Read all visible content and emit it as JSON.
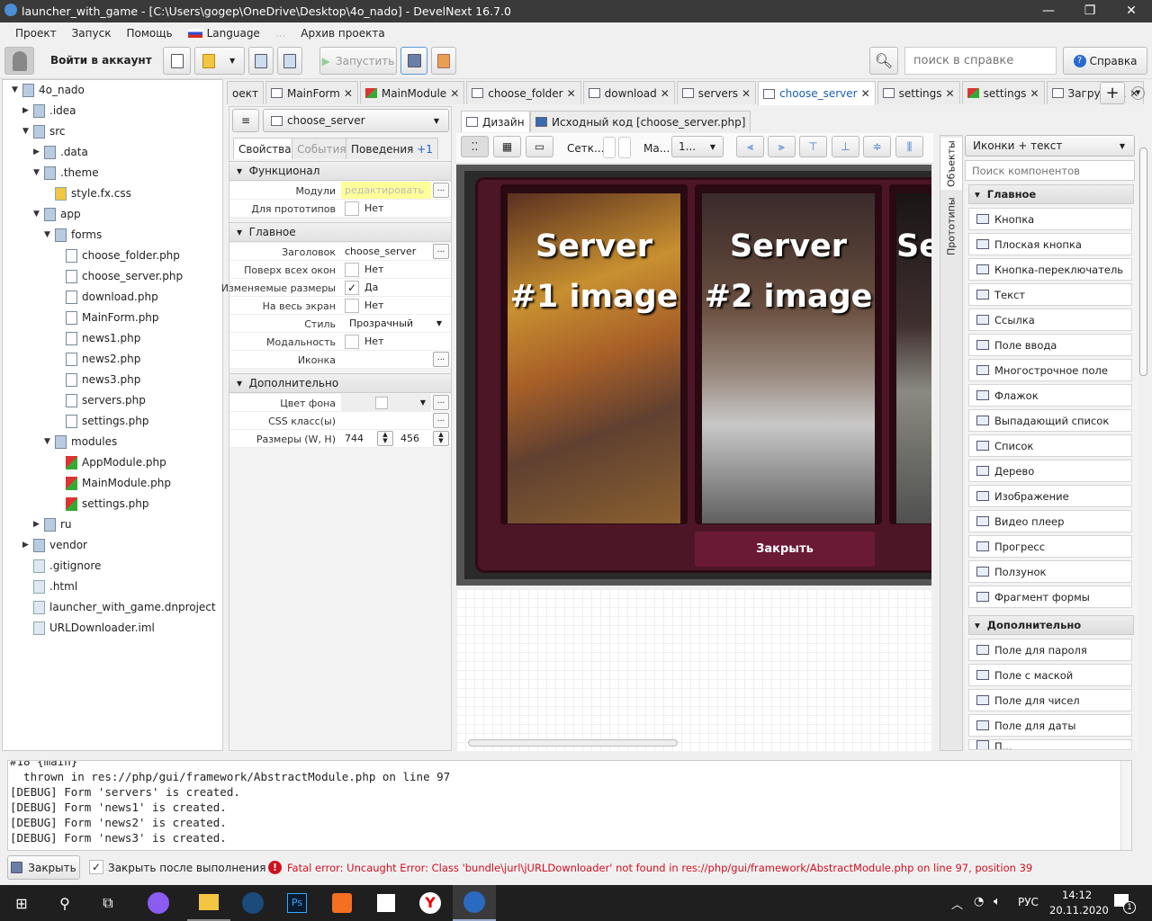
{
  "window": {
    "title": "launcher_with_game - [C:\\Users\\gogep\\OneDrive\\Desktop\\4o_nado] - DevelNext 16.7.0",
    "minimize": "—",
    "maximize": "❐",
    "close": "✕"
  },
  "menu": [
    "Проект",
    "Запуск",
    "Помощь",
    "Language",
    "...",
    "Архив проекта"
  ],
  "toolbar": {
    "login": "Войти в аккаунт",
    "run": "Запустить",
    "search_placeholder": "поиск в справке",
    "help": "Справка"
  },
  "tree": [
    {
      "label": "4o_nado",
      "depth": 0,
      "arrow": "▼",
      "type": "folder"
    },
    {
      "label": ".idea",
      "depth": 1,
      "arrow": "▶",
      "type": "folder"
    },
    {
      "label": "src",
      "depth": 1,
      "arrow": "▼",
      "type": "folder"
    },
    {
      "label": ".data",
      "depth": 2,
      "arrow": "▶",
      "type": "folder"
    },
    {
      "label": ".theme",
      "depth": 2,
      "arrow": "▼",
      "type": "folder"
    },
    {
      "label": "style.fx.css",
      "depth": 3,
      "arrow": "",
      "type": "css"
    },
    {
      "label": "app",
      "depth": 2,
      "arrow": "▼",
      "type": "folder"
    },
    {
      "label": "forms",
      "depth": 3,
      "arrow": "▼",
      "type": "folder"
    },
    {
      "label": "choose_folder.php",
      "depth": 4,
      "arrow": "",
      "type": "php"
    },
    {
      "label": "choose_server.php",
      "depth": 4,
      "arrow": "",
      "type": "php"
    },
    {
      "label": "download.php",
      "depth": 4,
      "arrow": "",
      "type": "php"
    },
    {
      "label": "MainForm.php",
      "depth": 4,
      "arrow": "",
      "type": "php"
    },
    {
      "label": "news1.php",
      "depth": 4,
      "arrow": "",
      "type": "php"
    },
    {
      "label": "news2.php",
      "depth": 4,
      "arrow": "",
      "type": "php"
    },
    {
      "label": "news3.php",
      "depth": 4,
      "arrow": "",
      "type": "php"
    },
    {
      "label": "servers.php",
      "depth": 4,
      "arrow": "",
      "type": "php"
    },
    {
      "label": "settings.php",
      "depth": 4,
      "arrow": "",
      "type": "php"
    },
    {
      "label": "modules",
      "depth": 3,
      "arrow": "▼",
      "type": "folder"
    },
    {
      "label": "AppModule.php",
      "depth": 4,
      "arrow": "",
      "type": "mod"
    },
    {
      "label": "MainModule.php",
      "depth": 4,
      "arrow": "",
      "type": "mod"
    },
    {
      "label": "settings.php",
      "depth": 4,
      "arrow": "",
      "type": "mod"
    },
    {
      "label": "ru",
      "depth": 2,
      "arrow": "▶",
      "type": "folder"
    },
    {
      "label": "vendor",
      "depth": 1,
      "arrow": "▶",
      "type": "folder"
    },
    {
      "label": ".gitignore",
      "depth": 1,
      "arrow": "",
      "type": "file"
    },
    {
      "label": ".html",
      "depth": 1,
      "arrow": "",
      "type": "file"
    },
    {
      "label": "launcher_with_game.dnproject",
      "depth": 1,
      "arrow": "",
      "type": "file"
    },
    {
      "label": "URLDownloader.iml",
      "depth": 1,
      "arrow": "",
      "type": "file"
    }
  ],
  "tabs": [
    {
      "label": "оект",
      "type": "plain",
      "close": false
    },
    {
      "label": "MainForm",
      "type": "form",
      "close": true
    },
    {
      "label": "MainModule",
      "type": "mod",
      "close": true
    },
    {
      "label": "choose_folder",
      "type": "form",
      "close": true
    },
    {
      "label": "download",
      "type": "form",
      "close": true
    },
    {
      "label": "servers",
      "type": "form",
      "close": true
    },
    {
      "label": "choose_server",
      "type": "form",
      "close": true,
      "active": true
    },
    {
      "label": "settings",
      "type": "form",
      "close": true
    },
    {
      "label": "settings",
      "type": "mod",
      "close": true
    },
    {
      "label": "Загрузчик",
      "type": "form",
      "close": true
    }
  ],
  "props": {
    "form_select": "choose_server",
    "tabs": [
      "Свойства",
      "События",
      "Поведения"
    ],
    "behaviors_badge": "+1",
    "sections": {
      "func": "Функционал",
      "main": "Главное",
      "extra": "Дополнительно"
    },
    "modules_label": "Модули",
    "modules_value": "редактировать",
    "proto_label": "Для прототипов",
    "proto_value": "Нет",
    "title_label": "Заголовок",
    "title_value": "choose_server",
    "ontop_label": "Поверх всех окон",
    "ontop_value": "Нет",
    "resize_label": "Изменяемые размеры",
    "resize_value": "Да",
    "full_label": "На весь экран",
    "full_value": "Нет",
    "style_label": "Стиль",
    "style_value": "Прозрачный",
    "modal_label": "Модальность",
    "modal_value": "Нет",
    "icon_label": "Иконка",
    "bg_label": "Цвет фона",
    "css_label": "CSS класс(ы)",
    "size_label": "Размеры (W, H)",
    "width": "744",
    "height": "456"
  },
  "design": {
    "tab_design": "Дизайн",
    "tab_source": "Исходный код [choose_server.php]",
    "grid_label": "Сетк...",
    "scale_label": "Ма...",
    "scale_value": "1...",
    "server1": "Server #1 image",
    "server2": "Server #2 image",
    "server3": "Se",
    "close_button": "Закрыть",
    "accent": "#6b1a35"
  },
  "side_tabs": [
    "Объекты",
    "Прототипы"
  ],
  "palette": {
    "view": "Иконки + текст",
    "search_placeholder": "Поиск компонентов",
    "main_title": "Главное",
    "main": [
      "Кнопка",
      "Плоская кнопка",
      "Кнопка-переключатель",
      "Текст",
      "Ссылка",
      "Поле ввода",
      "Многострочное поле",
      "Флажок",
      "Выпадающий список",
      "Список",
      "Дерево",
      "Изображение",
      "Видео плеер",
      "Прогресс",
      "Ползунок",
      "Фрагмент формы"
    ],
    "extra_title": "Дополнительно",
    "extra": [
      "Поле для пароля",
      "Поле с маской",
      "Поле для чисел",
      "Поле для даты",
      "П..."
    ]
  },
  "console": [
    "#18 {main}",
    "  thrown in res://php/gui/framework/AbstractModule.php on line 97",
    "[DEBUG] Form 'servers' is created.",
    "[DEBUG] Form 'news1' is created.",
    "[DEBUG] Form 'news2' is created.",
    "[DEBUG] Form 'news3' is created."
  ],
  "status": {
    "close": "Закрыть",
    "close_after": "Закрыть после выполнения",
    "error": "Fatal error: Uncaught Error: Class 'bundle\\jurl\\jURLDownloader' not found in res://php/gui/framework/AbstractModule.php on line 97, position 39",
    "error_color": "#d01020"
  },
  "taskbar": {
    "lang": "РУС",
    "time": "14:12",
    "date": "20.11.2020",
    "notifications": "1"
  }
}
